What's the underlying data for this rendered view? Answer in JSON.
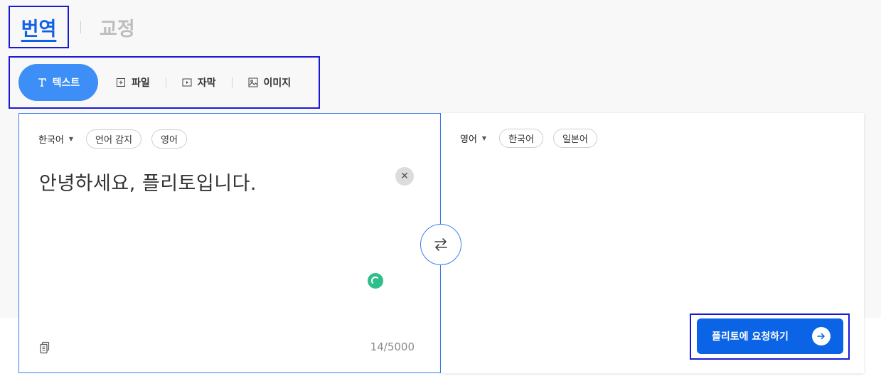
{
  "main_tabs": {
    "translate": "번역",
    "proofread": "교정"
  },
  "sub_tabs": [
    {
      "label": "텍스트",
      "icon": "text-icon"
    },
    {
      "label": "파일",
      "icon": "file-add-icon"
    },
    {
      "label": "자막",
      "icon": "video-play-icon"
    },
    {
      "label": "이미지",
      "icon": "image-icon"
    }
  ],
  "source": {
    "language": "한국어",
    "chips": [
      "언어 감지",
      "영어"
    ],
    "text": "안녕하세요, 플리토입니다.",
    "char_count": "14/5000"
  },
  "target": {
    "language": "영어",
    "chips": [
      "한국어",
      "일본어"
    ]
  },
  "request_button": "플리토에 요청하기",
  "colors": {
    "accent": "#3d8ef6",
    "primary": "#0b63e5",
    "success": "#2fbf8a"
  }
}
